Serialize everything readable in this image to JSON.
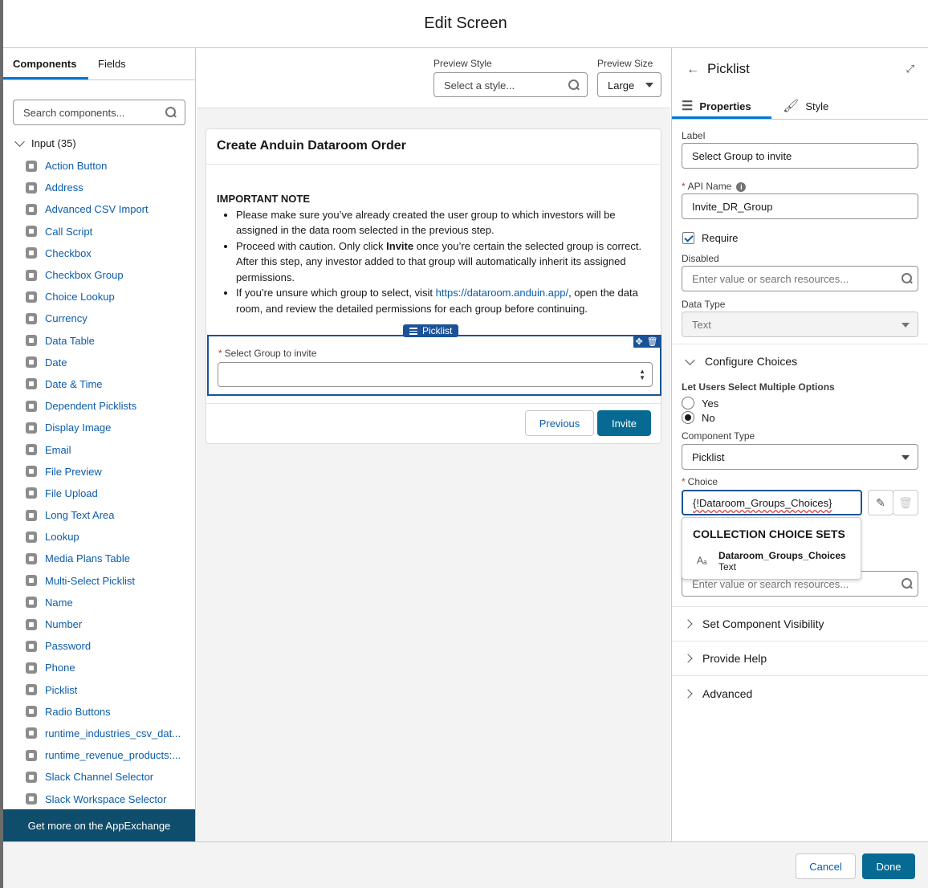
{
  "header": {
    "title": "Edit Screen"
  },
  "left": {
    "tabs": [
      "Components",
      "Fields"
    ],
    "search_placeholder": "Search components...",
    "group_label": "Input (35)",
    "components": [
      "Action Button",
      "Address",
      "Advanced CSV Import",
      "Call Script",
      "Checkbox",
      "Checkbox Group",
      "Choice Lookup",
      "Currency",
      "Data Table",
      "Date",
      "Date & Time",
      "Dependent Picklists",
      "Display Image",
      "Email",
      "File Preview",
      "File Upload",
      "Long Text Area",
      "Lookup",
      "Media Plans Table",
      "Multi-Select Picklist",
      "Name",
      "Number",
      "Password",
      "Phone",
      "Picklist",
      "Radio Buttons",
      "runtime_industries_csv_dat...",
      "runtime_revenue_products:...",
      "Slack Channel Selector",
      "Slack Workspace Selector"
    ],
    "appexchange": "Get more on the AppExchange"
  },
  "center": {
    "preview_style_label": "Preview Style",
    "preview_style_placeholder": "Select a style...",
    "preview_size_label": "Preview Size",
    "preview_size_value": "Large",
    "card_title": "Create Anduin Dataroom Order",
    "note_heading": "IMPORTANT NOTE",
    "bullet1": "Please make sure you’ve already created the user group to which investors will be assigned in the data room selected in the previous step.",
    "bullet2_a": "Proceed with caution. Only click ",
    "bullet2_b": "Invite",
    "bullet2_c": " once you’re certain the selected group is correct. After this step, any investor added to that group will automatically inherit its assigned permissions.",
    "bullet3_a": "If you’re unsure which group to select, visit ",
    "bullet3_link": "https://dataroom.anduin.app/",
    "bullet3_c": ", open the data room, and review the detailed permissions for each group before continuing.",
    "picklist_tag": "Picklist",
    "field_label": "Select Group to invite",
    "previous": "Previous",
    "invite": "Invite"
  },
  "right": {
    "title": "Picklist",
    "tabs": [
      "Properties",
      "Style"
    ],
    "label_label": "Label",
    "label_value": "Select Group to invite",
    "api_label": "API Name",
    "api_value": "Invite_DR_Group",
    "require": "Require",
    "disabled_label": "Disabled",
    "resource_placeholder": "Enter value or search resources...",
    "datatype_label": "Data Type",
    "datatype_value": "Text",
    "configure": "Configure Choices",
    "multi_label": "Let Users Select Multiple Options",
    "yes": "Yes",
    "no": "No",
    "comptype_label": "Component Type",
    "comptype_value": "Picklist",
    "choice_label": "Choice",
    "choice_value": "{!Dataroom_Groups_Choices}",
    "dropdown_heading": "COLLECTION CHOICE SETS",
    "dropdown_item": "Dataroom_Groups_Choices",
    "dropdown_item_type": "Text",
    "visibility": "Set Component Visibility",
    "help": "Provide Help",
    "advanced": "Advanced"
  },
  "footer": {
    "cancel": "Cancel",
    "done": "Done"
  },
  "colors": {
    "brand": "#066a93",
    "link": "#0b5cab",
    "selected_border": "#1b5297",
    "appexchange_bg": "#0f4d6c"
  }
}
